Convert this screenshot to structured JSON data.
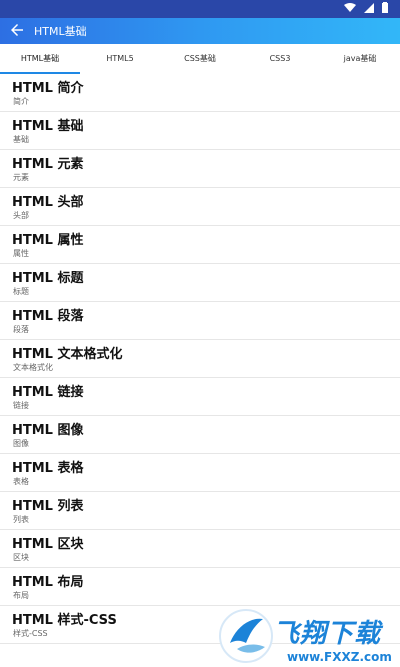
{
  "appbar": {
    "title": "HTML基础"
  },
  "tabs": [
    {
      "label": "HTML基础"
    },
    {
      "label": "HTML5"
    },
    {
      "label": "CSS基础"
    },
    {
      "label": "CSS3"
    },
    {
      "label": "java基础"
    }
  ],
  "list": {
    "items": [
      {
        "title": "HTML 简介",
        "subtitle": "简介"
      },
      {
        "title": "HTML 基础",
        "subtitle": "基础"
      },
      {
        "title": "HTML 元素",
        "subtitle": "元素"
      },
      {
        "title": "HTML 头部",
        "subtitle": "头部"
      },
      {
        "title": "HTML 属性",
        "subtitle": "属性"
      },
      {
        "title": "HTML 标题",
        "subtitle": "标题"
      },
      {
        "title": "HTML 段落",
        "subtitle": "段落"
      },
      {
        "title": "HTML 文本格式化",
        "subtitle": "文本格式化"
      },
      {
        "title": "HTML 链接",
        "subtitle": "链接"
      },
      {
        "title": "HTML 图像",
        "subtitle": "图像"
      },
      {
        "title": "HTML 表格",
        "subtitle": "表格"
      },
      {
        "title": "HTML 列表",
        "subtitle": "列表"
      },
      {
        "title": "HTML 区块",
        "subtitle": "区块"
      },
      {
        "title": "HTML 布局",
        "subtitle": "布局"
      },
      {
        "title": "HTML 样式-CSS",
        "subtitle": "样式-CSS"
      }
    ]
  },
  "watermark": {
    "brand": "飞翔下载",
    "url": "www.FXXZ.com"
  },
  "colors": {
    "status_bar": "#2a47a8",
    "appbar_start": "#2d6fe3",
    "appbar_end": "#32b7f8",
    "tab_indicator": "#1e88e5",
    "watermark": "#1c83d8"
  }
}
